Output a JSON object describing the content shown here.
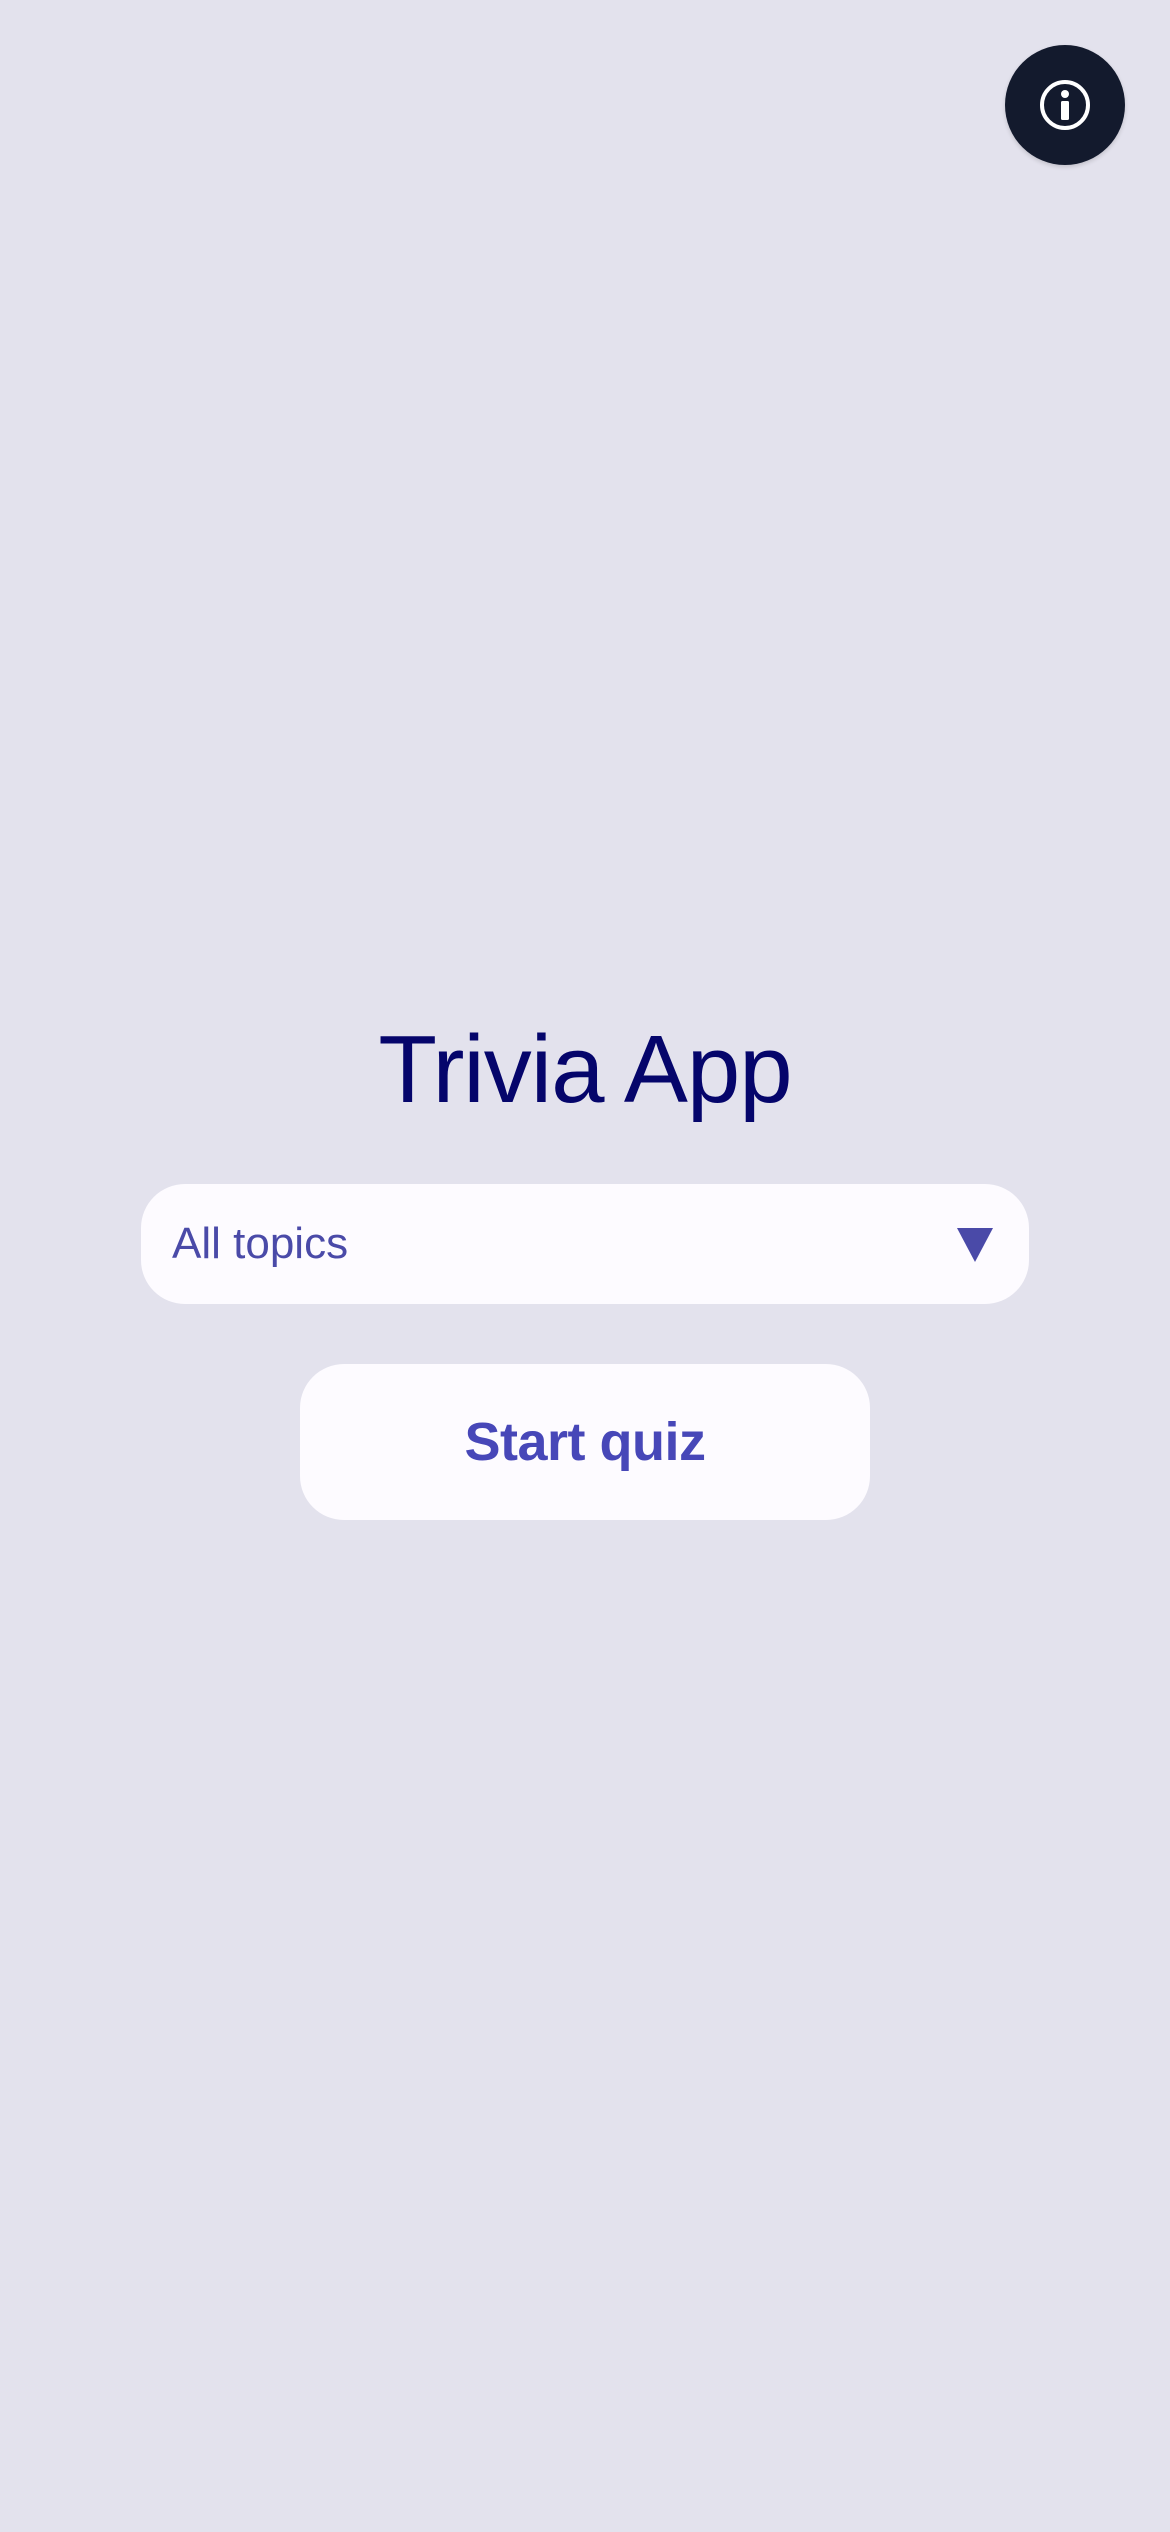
{
  "app": {
    "title": "Trivia App"
  },
  "header": {
    "info_button_icon": "info-icon"
  },
  "topic_select": {
    "selected": "All topics",
    "icon": "chevron-down-icon"
  },
  "actions": {
    "start_label": "Start quiz"
  },
  "colors": {
    "background": "#e3e2ed",
    "title": "#05056b",
    "accent": "#4a4aa8",
    "surface": "#fdfbff",
    "info_button": "#131a2d"
  }
}
